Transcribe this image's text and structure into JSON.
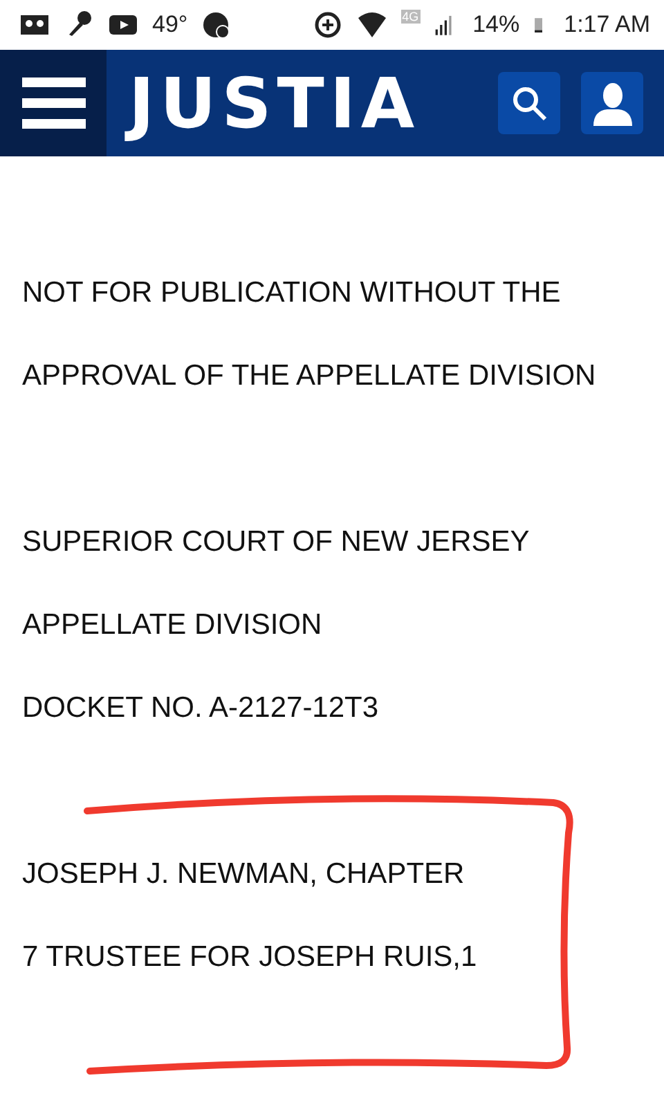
{
  "status_bar": {
    "temperature": "49°",
    "network": "4G",
    "battery": "14%",
    "time": "1:17 AM"
  },
  "header": {
    "logo": "JUSTIA"
  },
  "document": {
    "blocks": [
      {
        "lines": [
          "NOT FOR PUBLICATION WITHOUT THE",
          "APPROVAL OF THE APPELLATE DIVISION"
        ]
      },
      {
        "lines": [
          "SUPERIOR COURT OF NEW JERSEY",
          "APPELLATE DIVISION",
          "DOCKET NO. A-2127-12T3"
        ]
      },
      {
        "lines": [
          "JOSEPH J. NEWMAN, CHAPTER",
          "7 TRUSTEE FOR JOSEPH RUIS,1"
        ]
      }
    ]
  }
}
